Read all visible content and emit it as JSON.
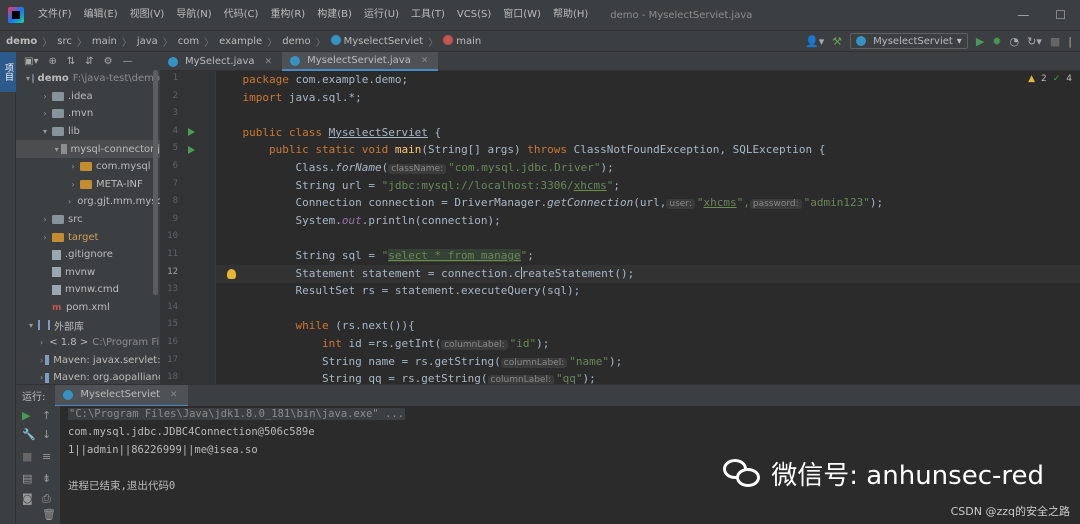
{
  "window": {
    "title": "demo - MyselectServiet.java"
  },
  "menu": [
    "文件(F)",
    "编辑(E)",
    "视图(V)",
    "导航(N)",
    "代码(C)",
    "重构(R)",
    "构建(B)",
    "运行(U)",
    "工具(T)",
    "VCS(S)",
    "窗口(W)",
    "帮助(H)"
  ],
  "breadcrumb": [
    "demo",
    "src",
    "main",
    "java",
    "com",
    "example",
    "demo",
    "MyselectServiet",
    "main"
  ],
  "run_config": "MyselectServiet",
  "left_stripe": {
    "project": "项目"
  },
  "project_tree": [
    {
      "label": "demo",
      "path": "F:\\java-test\\demo",
      "bold": true
    },
    {
      "label": ".idea"
    },
    {
      "label": ".mvn"
    },
    {
      "label": "lib"
    },
    {
      "label": "mysql-connector-j"
    },
    {
      "label": "com.mysql"
    },
    {
      "label": "META-INF"
    },
    {
      "label": "org.gjt.mm.mysql"
    },
    {
      "label": "src"
    },
    {
      "label": "target"
    },
    {
      "label": ".gitignore"
    },
    {
      "label": "mvnw"
    },
    {
      "label": "mvnw.cmd"
    },
    {
      "label": "pom.xml"
    },
    {
      "label": "外部库"
    },
    {
      "label": "< 1.8 >",
      "path": "C:\\Program Files"
    },
    {
      "label": "Maven: javax.servlet:javax.servlet-api"
    },
    {
      "label": "Maven: org.aopalliance"
    }
  ],
  "editor_tabs": [
    {
      "label": "MySelect.java",
      "active": false
    },
    {
      "label": "MyselectServiet.java",
      "active": true
    }
  ],
  "indicators": {
    "warnings": "2",
    "checks": "4"
  },
  "line_numbers": [
    "1",
    "2",
    "3",
    "4",
    "5",
    "6",
    "7",
    "8",
    "9",
    "10",
    "11",
    "12",
    "13",
    "14",
    "15",
    "16",
    "17",
    "18"
  ],
  "code": {
    "l1a": "package",
    "l1b": " com.example.demo;",
    "l2a": "import",
    "l2b": " java.sql.*;",
    "l4a": "public class ",
    "l4b": "MyselectServiet",
    "l4c": " {",
    "l5a": "    public static void ",
    "l5b": "main",
    "l5c": "(String[] args) ",
    "l5d": "throws",
    "l5e": " ClassNotFoundException, SQLException {",
    "l6a": "        Class.",
    "l6b": "forName",
    "l6c": "(",
    "l6h": "className:",
    "l6d": "\"com.mysql.jdbc.Driver\"",
    "l6e": ");",
    "l7a": "        String url = ",
    "l7b": "\"jdbc:mysql://localhost:3306/",
    "l7c": "xhcms",
    "l7d": "\"",
    "l7e": ";",
    "l8a": "        Connection connection = DriverManager.",
    "l8b": "getConnection",
    "l8c": "(url,",
    "l8h1": "user:",
    "l8d": "\"",
    "l8e": "xhcms",
    "l8f": "\",",
    "l8h2": "password:",
    "l8g": "\"admin123\"",
    "l8i": ");",
    "l9a": "        System.",
    "l9b": "out",
    "l9c": ".println(connection);",
    "l11a": "        String sql = ",
    "l11b": "\"",
    "l11c": "select * from manage",
    "l11d": "\"",
    "l11e": ";",
    "l12a": "        Statement statement = connection.",
    "l12b": "c",
    "l12c": "reateStatement",
    "l12d": "();",
    "l13a": "        ResultSet rs = statement.executeQuery(sql);",
    "l15a": "        ",
    "l15b": "while",
    "l15c": " (rs.next()){",
    "l16a": "            ",
    "l16b": "int",
    "l16c": " id =rs.getInt(",
    "l16h": "columnLabel:",
    "l16d": "\"id\"",
    "l16e": ");",
    "l17a": "            String name = rs.getString(",
    "l17h": "columnLabel:",
    "l17d": "\"name\"",
    "l17e": ");",
    "l18a": "            String qq = rs.getString(",
    "l18h": "columnLabel:",
    "l18d": "\"qq\"",
    "l18e": ");"
  },
  "run_panel": {
    "label": "运行:",
    "tab": "MyselectServiet",
    "console": [
      "\"C:\\Program Files\\Java\\jdk1.8.0_181\\bin\\java.exe\" ...",
      "com.mysql.jdbc.JDBC4Connection@506c589e",
      "1||admin||86226999||me@isea.so",
      "",
      "进程已结束,退出代码0"
    ]
  },
  "watermark": {
    "text": "微信号: anhunsec-red",
    "credit": "CSDN @zzq的安全之路"
  }
}
